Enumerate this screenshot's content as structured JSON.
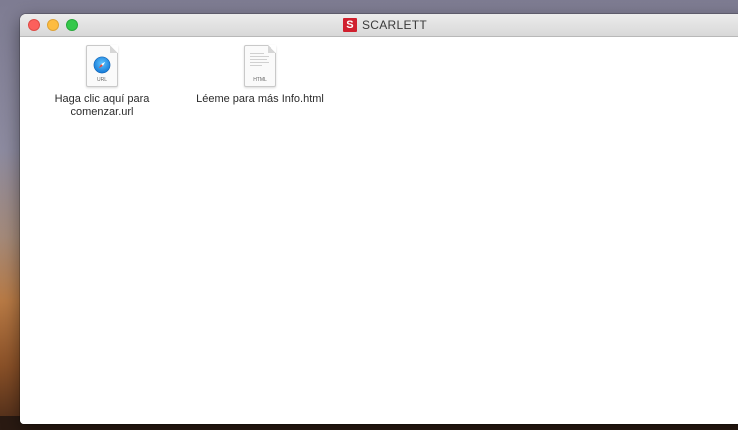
{
  "window": {
    "title": "SCARLETT",
    "logo_letter": "S",
    "logo_color": "#d0202e"
  },
  "traffic_lights": {
    "close_color": "#fc605c",
    "minimize_color": "#fdbc40",
    "zoom_color": "#34c84a"
  },
  "files": [
    {
      "label_line1": "Haga clic aquí para",
      "label_line2": "comenzar.url",
      "icon": "safari-url-icon",
      "badge": "URL"
    },
    {
      "label_line1": "Léeme para más Info.html",
      "icon": "html-document-icon",
      "badge": "HTML"
    }
  ]
}
